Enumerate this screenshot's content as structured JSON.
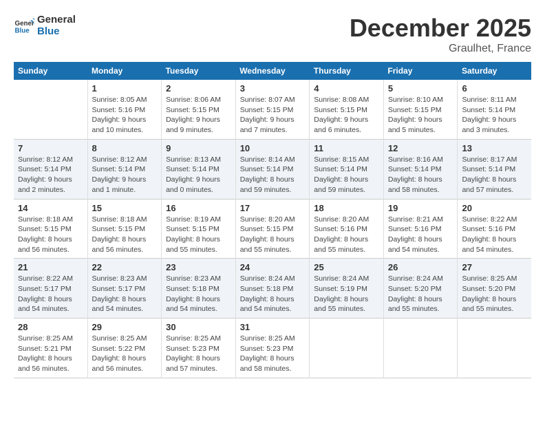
{
  "header": {
    "logo_line1": "General",
    "logo_line2": "Blue",
    "month_title": "December 2025",
    "subtitle": "Graulhet, France"
  },
  "days_of_week": [
    "Sunday",
    "Monday",
    "Tuesday",
    "Wednesday",
    "Thursday",
    "Friday",
    "Saturday"
  ],
  "weeks": [
    [
      {
        "day": "",
        "info": ""
      },
      {
        "day": "1",
        "info": "Sunrise: 8:05 AM\nSunset: 5:16 PM\nDaylight: 9 hours\nand 10 minutes."
      },
      {
        "day": "2",
        "info": "Sunrise: 8:06 AM\nSunset: 5:15 PM\nDaylight: 9 hours\nand 9 minutes."
      },
      {
        "day": "3",
        "info": "Sunrise: 8:07 AM\nSunset: 5:15 PM\nDaylight: 9 hours\nand 7 minutes."
      },
      {
        "day": "4",
        "info": "Sunrise: 8:08 AM\nSunset: 5:15 PM\nDaylight: 9 hours\nand 6 minutes."
      },
      {
        "day": "5",
        "info": "Sunrise: 8:10 AM\nSunset: 5:15 PM\nDaylight: 9 hours\nand 5 minutes."
      },
      {
        "day": "6",
        "info": "Sunrise: 8:11 AM\nSunset: 5:14 PM\nDaylight: 9 hours\nand 3 minutes."
      }
    ],
    [
      {
        "day": "7",
        "info": "Sunrise: 8:12 AM\nSunset: 5:14 PM\nDaylight: 9 hours\nand 2 minutes."
      },
      {
        "day": "8",
        "info": "Sunrise: 8:12 AM\nSunset: 5:14 PM\nDaylight: 9 hours\nand 1 minute."
      },
      {
        "day": "9",
        "info": "Sunrise: 8:13 AM\nSunset: 5:14 PM\nDaylight: 9 hours\nand 0 minutes."
      },
      {
        "day": "10",
        "info": "Sunrise: 8:14 AM\nSunset: 5:14 PM\nDaylight: 8 hours\nand 59 minutes."
      },
      {
        "day": "11",
        "info": "Sunrise: 8:15 AM\nSunset: 5:14 PM\nDaylight: 8 hours\nand 59 minutes."
      },
      {
        "day": "12",
        "info": "Sunrise: 8:16 AM\nSunset: 5:14 PM\nDaylight: 8 hours\nand 58 minutes."
      },
      {
        "day": "13",
        "info": "Sunrise: 8:17 AM\nSunset: 5:14 PM\nDaylight: 8 hours\nand 57 minutes."
      }
    ],
    [
      {
        "day": "14",
        "info": "Sunrise: 8:18 AM\nSunset: 5:15 PM\nDaylight: 8 hours\nand 56 minutes."
      },
      {
        "day": "15",
        "info": "Sunrise: 8:18 AM\nSunset: 5:15 PM\nDaylight: 8 hours\nand 56 minutes."
      },
      {
        "day": "16",
        "info": "Sunrise: 8:19 AM\nSunset: 5:15 PM\nDaylight: 8 hours\nand 55 minutes."
      },
      {
        "day": "17",
        "info": "Sunrise: 8:20 AM\nSunset: 5:15 PM\nDaylight: 8 hours\nand 55 minutes."
      },
      {
        "day": "18",
        "info": "Sunrise: 8:20 AM\nSunset: 5:16 PM\nDaylight: 8 hours\nand 55 minutes."
      },
      {
        "day": "19",
        "info": "Sunrise: 8:21 AM\nSunset: 5:16 PM\nDaylight: 8 hours\nand 54 minutes."
      },
      {
        "day": "20",
        "info": "Sunrise: 8:22 AM\nSunset: 5:16 PM\nDaylight: 8 hours\nand 54 minutes."
      }
    ],
    [
      {
        "day": "21",
        "info": "Sunrise: 8:22 AM\nSunset: 5:17 PM\nDaylight: 8 hours\nand 54 minutes."
      },
      {
        "day": "22",
        "info": "Sunrise: 8:23 AM\nSunset: 5:17 PM\nDaylight: 8 hours\nand 54 minutes."
      },
      {
        "day": "23",
        "info": "Sunrise: 8:23 AM\nSunset: 5:18 PM\nDaylight: 8 hours\nand 54 minutes."
      },
      {
        "day": "24",
        "info": "Sunrise: 8:24 AM\nSunset: 5:18 PM\nDaylight: 8 hours\nand 54 minutes."
      },
      {
        "day": "25",
        "info": "Sunrise: 8:24 AM\nSunset: 5:19 PM\nDaylight: 8 hours\nand 55 minutes."
      },
      {
        "day": "26",
        "info": "Sunrise: 8:24 AM\nSunset: 5:20 PM\nDaylight: 8 hours\nand 55 minutes."
      },
      {
        "day": "27",
        "info": "Sunrise: 8:25 AM\nSunset: 5:20 PM\nDaylight: 8 hours\nand 55 minutes."
      }
    ],
    [
      {
        "day": "28",
        "info": "Sunrise: 8:25 AM\nSunset: 5:21 PM\nDaylight: 8 hours\nand 56 minutes."
      },
      {
        "day": "29",
        "info": "Sunrise: 8:25 AM\nSunset: 5:22 PM\nDaylight: 8 hours\nand 56 minutes."
      },
      {
        "day": "30",
        "info": "Sunrise: 8:25 AM\nSunset: 5:23 PM\nDaylight: 8 hours\nand 57 minutes."
      },
      {
        "day": "31",
        "info": "Sunrise: 8:25 AM\nSunset: 5:23 PM\nDaylight: 8 hours\nand 58 minutes."
      },
      {
        "day": "",
        "info": ""
      },
      {
        "day": "",
        "info": ""
      },
      {
        "day": "",
        "info": ""
      }
    ]
  ]
}
